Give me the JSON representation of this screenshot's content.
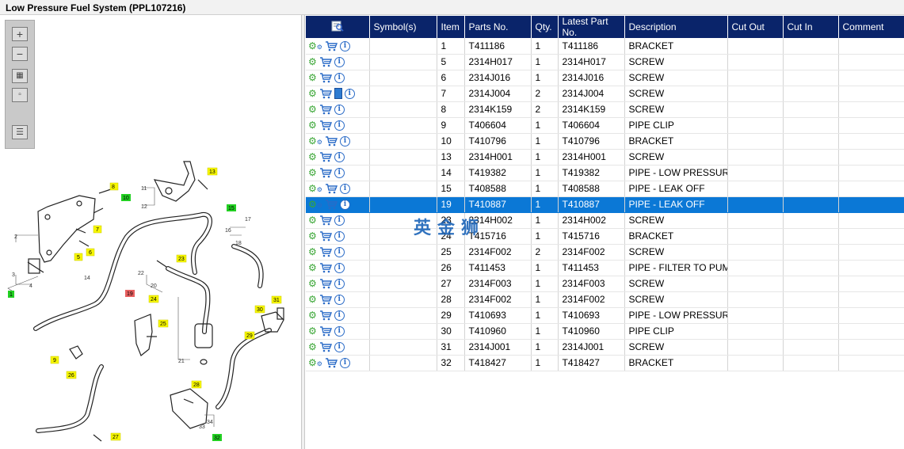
{
  "window": {
    "title": "Low Pressure Fuel System (PPL107216)"
  },
  "toolbar": {
    "zoom_in": "zoom-in-icon",
    "zoom_out": "zoom-out-icon",
    "fit": "fit-all-icon",
    "actual": "actual-size-icon",
    "list": "list-view-icon"
  },
  "diagram": {
    "labels_yellow": [
      "8",
      "13",
      "7",
      "5",
      "6",
      "23",
      "24",
      "25",
      "31",
      "30",
      "29",
      "9",
      "26",
      "28",
      "27"
    ],
    "labels_green": [
      "10",
      "15",
      "1",
      "32"
    ],
    "labels_red": [
      "19"
    ],
    "numbers": [
      "11",
      "12",
      "2",
      "3",
      "4",
      "14",
      "16",
      "17",
      "18",
      "20",
      "21",
      "22",
      "33",
      "34"
    ]
  },
  "table": {
    "columns": [
      "",
      "Symbol(s)",
      "Item",
      "Parts No.",
      "Qty.",
      "Latest Part No.",
      "Description",
      "Cut Out",
      "Cut In",
      "Comment"
    ],
    "rows": [
      {
        "gear": "multi",
        "doc": false,
        "item": "1",
        "part": "T411186",
        "qty": "1",
        "latest": "T411186",
        "desc": "BRACKET"
      },
      {
        "gear": "single",
        "doc": false,
        "item": "5",
        "part": "2314H017",
        "qty": "1",
        "latest": "2314H017",
        "desc": "SCREW"
      },
      {
        "gear": "single",
        "doc": false,
        "item": "6",
        "part": "2314J016",
        "qty": "1",
        "latest": "2314J016",
        "desc": "SCREW"
      },
      {
        "gear": "single",
        "doc": true,
        "item": "7",
        "part": "2314J004",
        "qty": "2",
        "latest": "2314J004",
        "desc": "SCREW"
      },
      {
        "gear": "single",
        "doc": false,
        "item": "8",
        "part": "2314K159",
        "qty": "2",
        "latest": "2314K159",
        "desc": "SCREW"
      },
      {
        "gear": "single",
        "doc": false,
        "item": "9",
        "part": "T406604",
        "qty": "1",
        "latest": "T406604",
        "desc": "PIPE CLIP"
      },
      {
        "gear": "multi",
        "doc": false,
        "item": "10",
        "part": "T410796",
        "qty": "1",
        "latest": "T410796",
        "desc": "BRACKET"
      },
      {
        "gear": "single",
        "doc": false,
        "item": "13",
        "part": "2314H001",
        "qty": "1",
        "latest": "2314H001",
        "desc": "SCREW"
      },
      {
        "gear": "single",
        "doc": false,
        "item": "14",
        "part": "T419382",
        "qty": "1",
        "latest": "T419382",
        "desc": "PIPE - LOW PRESSURE FU"
      },
      {
        "gear": "multi",
        "doc": false,
        "item": "15",
        "part": "T408588",
        "qty": "1",
        "latest": "T408588",
        "desc": "PIPE - LEAK OFF"
      },
      {
        "gear": "multi",
        "doc": false,
        "item": "19",
        "part": "T410887",
        "qty": "1",
        "latest": "T410887",
        "desc": "PIPE - LEAK OFF",
        "selected": true
      },
      {
        "gear": "single",
        "doc": false,
        "item": "23",
        "part": "2314H002",
        "qty": "1",
        "latest": "2314H002",
        "desc": "SCREW"
      },
      {
        "gear": "single",
        "doc": false,
        "item": "24",
        "part": "T415716",
        "qty": "1",
        "latest": "T415716",
        "desc": "BRACKET"
      },
      {
        "gear": "single",
        "doc": false,
        "item": "25",
        "part": "2314F002",
        "qty": "2",
        "latest": "2314F002",
        "desc": "SCREW"
      },
      {
        "gear": "single",
        "doc": false,
        "item": "26",
        "part": "T411453",
        "qty": "1",
        "latest": "T411453",
        "desc": "PIPE - FILTER TO PUMP"
      },
      {
        "gear": "single",
        "doc": false,
        "item": "27",
        "part": "2314F003",
        "qty": "1",
        "latest": "2314F003",
        "desc": "SCREW"
      },
      {
        "gear": "single",
        "doc": false,
        "item": "28",
        "part": "2314F002",
        "qty": "1",
        "latest": "2314F002",
        "desc": "SCREW"
      },
      {
        "gear": "single",
        "doc": false,
        "item": "29",
        "part": "T410693",
        "qty": "1",
        "latest": "T410693",
        "desc": "PIPE - LOW PRESSURE FU"
      },
      {
        "gear": "single",
        "doc": false,
        "item": "30",
        "part": "T410960",
        "qty": "1",
        "latest": "T410960",
        "desc": "PIPE CLIP"
      },
      {
        "gear": "single",
        "doc": false,
        "item": "31",
        "part": "2314J001",
        "qty": "1",
        "latest": "2314J001",
        "desc": "SCREW"
      },
      {
        "gear": "multi",
        "doc": false,
        "item": "32",
        "part": "T418427",
        "qty": "1",
        "latest": "T418427",
        "desc": "BRACKET"
      }
    ]
  },
  "watermark": "英金狮",
  "colors": {
    "header_bg": "#0a246a",
    "selected_bg": "#0b78d6",
    "label_yellow": "#f7f700",
    "label_green": "#22d022",
    "label_red": "#e86060"
  }
}
